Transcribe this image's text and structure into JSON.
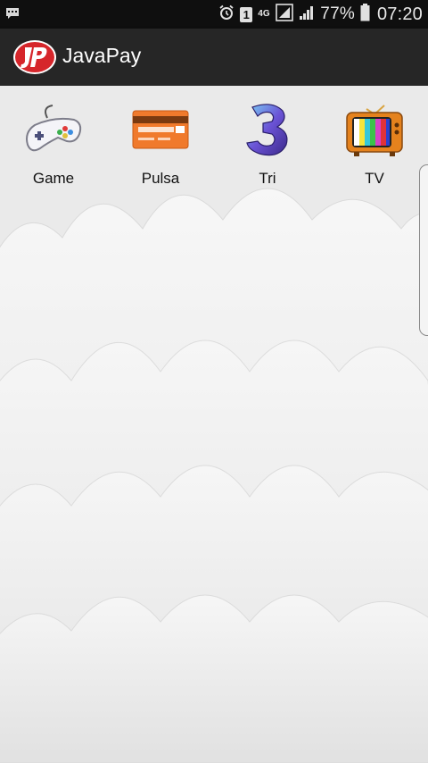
{
  "status_bar": {
    "notification_icon": "chat-notification-icon",
    "alarm_icon": "alarm-icon",
    "sim_badge": "1",
    "network_type": "4G",
    "battery_percent": "77%",
    "time": "07:20"
  },
  "app_bar": {
    "logo_text": "JP",
    "title": "JavaPay"
  },
  "categories": [
    {
      "label": "Game",
      "icon": "gamepad-icon"
    },
    {
      "label": "Pulsa",
      "icon": "credit-card-icon"
    },
    {
      "label": "Tri",
      "icon": "tri-logo-icon"
    },
    {
      "label": "TV",
      "icon": "television-icon"
    }
  ]
}
